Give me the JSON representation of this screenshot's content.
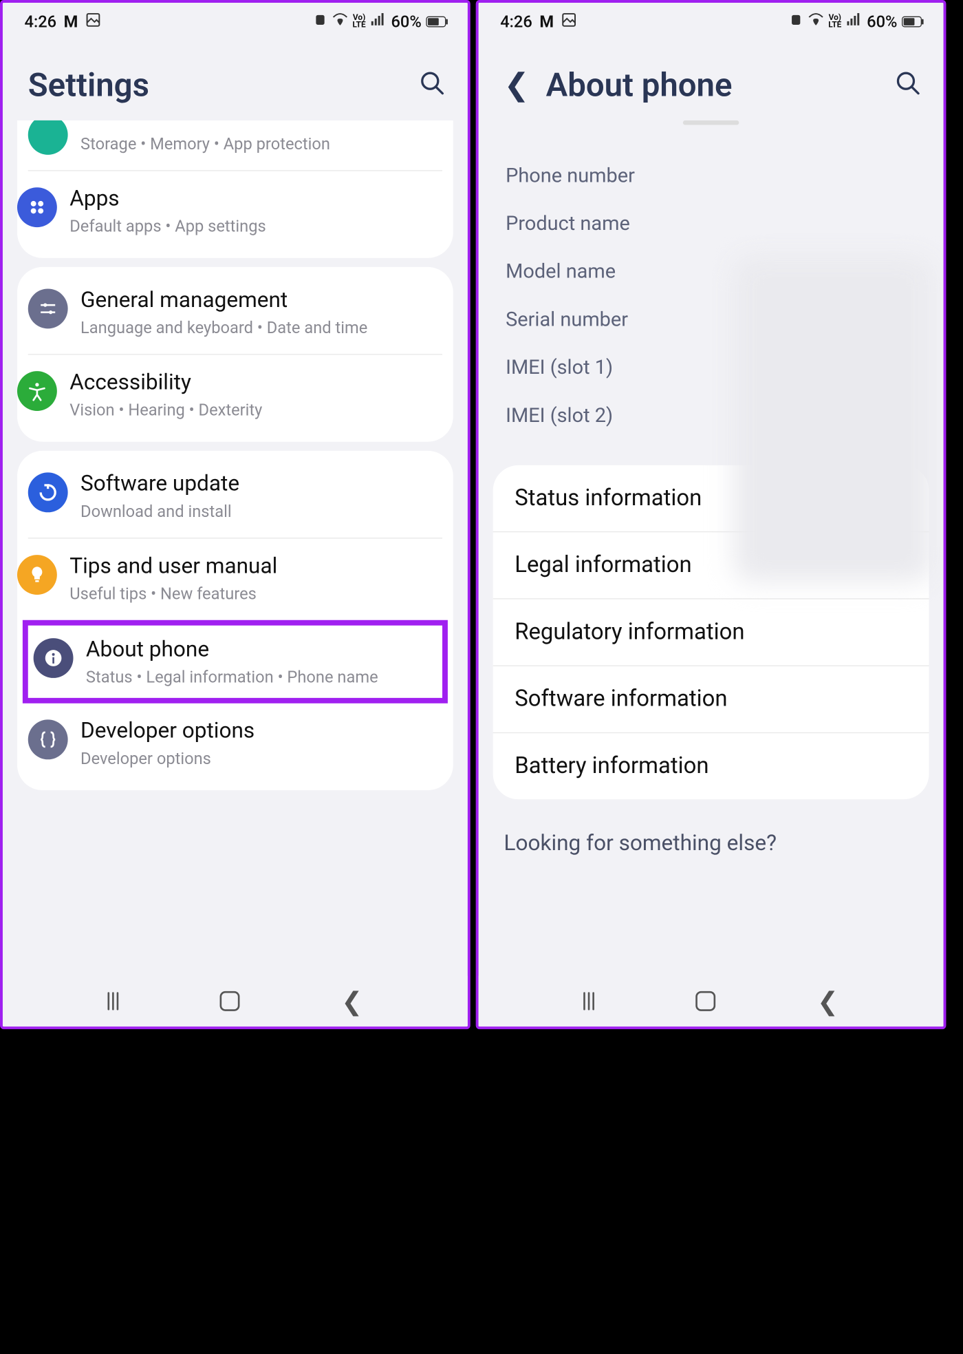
{
  "status": {
    "time": "4:26",
    "battery_pct": "60%",
    "volte": "Vo)\nLTE"
  },
  "left": {
    "title": "Settings",
    "partial_sub": "Storage  •  Memory  •  App protection",
    "groups": [
      {
        "items": [
          {
            "id": "apps",
            "title": "Apps",
            "sub": "Default apps  •  App settings",
            "color": "#3b5bdb"
          }
        ]
      },
      {
        "items": [
          {
            "id": "general-management",
            "title": "General management",
            "sub": "Language and keyboard  •  Date and time",
            "color": "#6b6f8e"
          },
          {
            "id": "accessibility",
            "title": "Accessibility",
            "sub": "Vision  •  Hearing  •  Dexterity",
            "color": "#2bac3a"
          }
        ]
      },
      {
        "items": [
          {
            "id": "software-update",
            "title": "Software update",
            "sub": "Download and install",
            "color": "#2b5fdd"
          },
          {
            "id": "tips",
            "title": "Tips and user manual",
            "sub": "Useful tips  •  New features",
            "color": "#f5a623"
          },
          {
            "id": "about-phone",
            "title": "About phone",
            "sub": "Status  •  Legal information  •  Phone name",
            "color": "#4a4e7a",
            "highlight": true
          },
          {
            "id": "developer-options",
            "title": "Developer options",
            "sub": "Developer options",
            "color": "#6b6f8e"
          }
        ]
      }
    ]
  },
  "right": {
    "title": "About phone",
    "info": [
      {
        "label": "Phone number"
      },
      {
        "label": "Product name"
      },
      {
        "label": "Model name"
      },
      {
        "label": "Serial number"
      },
      {
        "label": "IMEI (slot 1)"
      },
      {
        "label": "IMEI (slot 2)"
      }
    ],
    "links": [
      "Status information",
      "Legal information",
      "Regulatory information",
      "Software information",
      "Battery information"
    ],
    "looking": "Looking for something else?"
  }
}
